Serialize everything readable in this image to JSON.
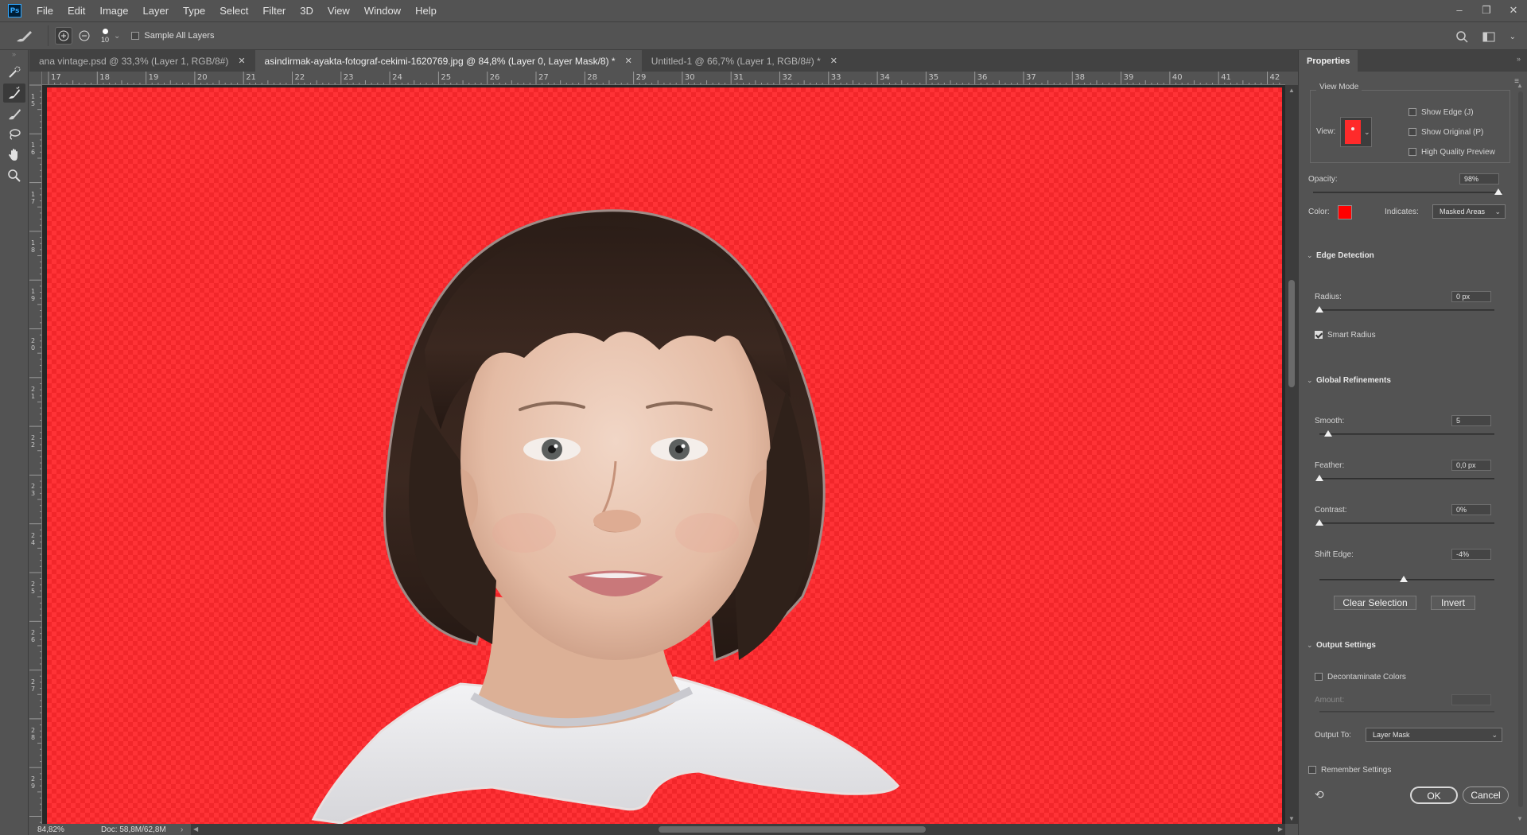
{
  "app": {
    "logo": "Ps"
  },
  "menu": {
    "items": [
      "File",
      "Edit",
      "Image",
      "Layer",
      "Type",
      "Select",
      "Filter",
      "3D",
      "View",
      "Window",
      "Help"
    ]
  },
  "window_controls": {
    "minimize": "–",
    "restore": "❐",
    "close": "✕"
  },
  "options_bar": {
    "brush_size": "10",
    "sample_all_layers_label": "Sample All Layers",
    "sample_all_layers_checked": false
  },
  "tabs": [
    {
      "label": "ana vintage.psd @ 33,3% (Layer 1, RGB/8#)",
      "active": false
    },
    {
      "label": "asindirmak-ayakta-fotograf-cekimi-1620769.jpg @ 84,8% (Layer 0, Layer Mask/8) *",
      "active": true
    },
    {
      "label": "Untitled-1 @ 66,7% (Layer 1, RGB/8#) *",
      "active": false
    }
  ],
  "ruler": {
    "top_labels": [
      "17",
      "18",
      "19",
      "20",
      "21",
      "22",
      "23",
      "24",
      "25",
      "26",
      "27",
      "28",
      "29",
      "30",
      "31",
      "32",
      "33",
      "34",
      "35",
      "36",
      "37",
      "38",
      "39",
      "40",
      "41",
      "42"
    ],
    "left_labels": [
      "15",
      "16",
      "17",
      "18",
      "19",
      "20",
      "21",
      "22",
      "23",
      "24",
      "25",
      "26",
      "27",
      "28",
      "29"
    ]
  },
  "status": {
    "zoom": "84,82%",
    "doc": "Doc: 58,8M/62,8M",
    "arrow": "›"
  },
  "properties": {
    "tab": "Properties",
    "view_mode": {
      "legend": "View Mode",
      "view_label": "View:",
      "show_edge": "Show Edge (J)",
      "show_original": "Show Original (P)",
      "high_quality": "High Quality Preview"
    },
    "opacity": {
      "label": "Opacity:",
      "value": "98%",
      "fraction": 0.98
    },
    "color": {
      "label": "Color:",
      "hex": "#ff0000"
    },
    "indicates": {
      "label": "Indicates:",
      "value": "Masked Areas"
    },
    "edge_detection": {
      "title": "Edge Detection",
      "radius_label": "Radius:",
      "radius_value": "0 px",
      "radius_fraction": 0.0,
      "smart_radius": "Smart Radius",
      "smart_radius_checked": true
    },
    "global_refinements": {
      "title": "Global Refinements",
      "smooth_label": "Smooth:",
      "smooth_value": "5",
      "smooth_fraction": 0.05,
      "feather_label": "Feather:",
      "feather_value": "0,0 px",
      "feather_fraction": 0.0,
      "contrast_label": "Contrast:",
      "contrast_value": "0%",
      "contrast_fraction": 0.0,
      "shift_edge_label": "Shift Edge:",
      "shift_edge_value": "-4%",
      "shift_edge_fraction": 0.48,
      "clear_selection": "Clear Selection",
      "invert": "Invert"
    },
    "output_settings": {
      "title": "Output Settings",
      "decontaminate": "Decontaminate Colors",
      "amount_label": "Amount:",
      "output_to_label": "Output To:",
      "output_to_value": "Layer Mask"
    },
    "remember": "Remember Settings",
    "ok": "OK",
    "cancel": "Cancel"
  },
  "colors": {
    "mask_overlay": "#f2262a",
    "accent_ps": "#31a8ff"
  }
}
